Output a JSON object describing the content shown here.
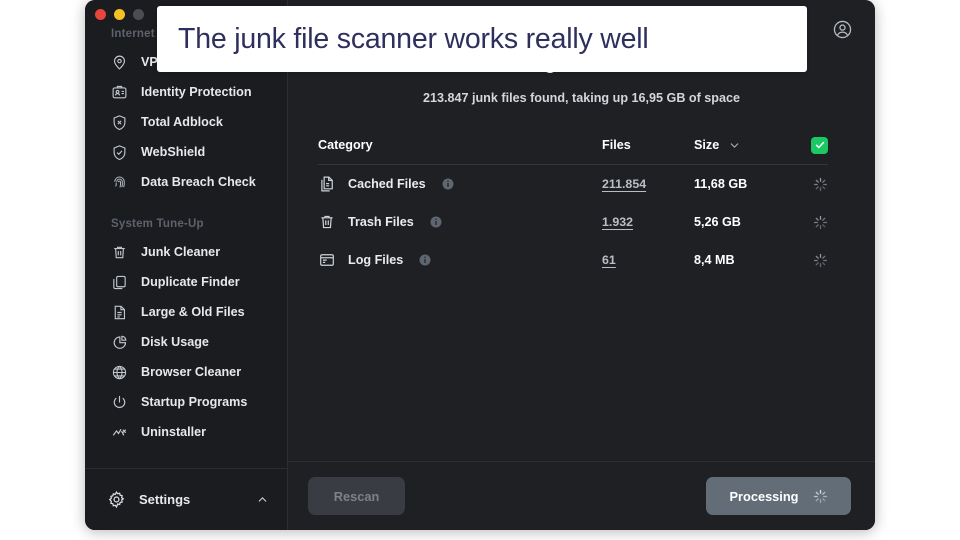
{
  "window": {
    "traffic_lights": [
      "close",
      "minimize",
      "maximize-disabled"
    ]
  },
  "caption": {
    "text": "The junk file scanner works really well",
    "text_color": "#2f2f5e",
    "background": "#ffffff"
  },
  "sidebar": {
    "sections": [
      {
        "label": "Internet Security",
        "items": [
          {
            "label": "VPN",
            "icon": "location-pin-icon"
          },
          {
            "label": "Identity Protection",
            "icon": "id-badge-icon"
          },
          {
            "label": "Total Adblock",
            "icon": "shield-x-icon"
          },
          {
            "label": "WebShield",
            "icon": "shield-check-icon"
          },
          {
            "label": "Data Breach Check",
            "icon": "fingerprint-icon"
          }
        ]
      },
      {
        "label": "System Tune-Up",
        "items": [
          {
            "label": "Junk Cleaner",
            "icon": "trash-icon"
          },
          {
            "label": "Duplicate Finder",
            "icon": "copy-icon"
          },
          {
            "label": "Large & Old Files",
            "icon": "document-icon"
          },
          {
            "label": "Disk Usage",
            "icon": "pie-chart-icon"
          },
          {
            "label": "Browser Cleaner",
            "icon": "globe-icon"
          },
          {
            "label": "Startup Programs",
            "icon": "power-icon"
          },
          {
            "label": "Uninstaller",
            "icon": "uninstall-icon"
          }
        ]
      }
    ],
    "settings": {
      "label": "Settings",
      "icon": "gear-icon",
      "chevron": "chevron-up-icon"
    }
  },
  "main": {
    "account_icon": "account-circle-icon",
    "title": "Manage Junk Files",
    "subtitle": "213.847 junk files found, taking up 16,95 GB of space",
    "table": {
      "columns": {
        "category": "Category",
        "files": "Files",
        "size": "Size",
        "sort_icon": "chevron-down-icon",
        "select_all_icon": "checkmark-icon",
        "select_all_color": "#1bc964"
      },
      "rows": [
        {
          "icon": "cached-files-icon",
          "category": "Cached Files",
          "info_icon": "info-icon",
          "files": "211.854",
          "size": "11,68 GB",
          "action_icon": "spinner-icon"
        },
        {
          "icon": "trash-icon",
          "category": "Trash Files",
          "info_icon": "info-icon",
          "files": "1.932",
          "size": "5,26 GB",
          "action_icon": "spinner-icon"
        },
        {
          "icon": "log-files-icon",
          "category": "Log Files",
          "info_icon": "info-icon",
          "files": "61",
          "size": "8,4 MB",
          "action_icon": "spinner-icon"
        }
      ]
    },
    "footer": {
      "rescan_label": "Rescan",
      "processing_label": "Processing",
      "processing_icon": "spinner-icon"
    }
  }
}
